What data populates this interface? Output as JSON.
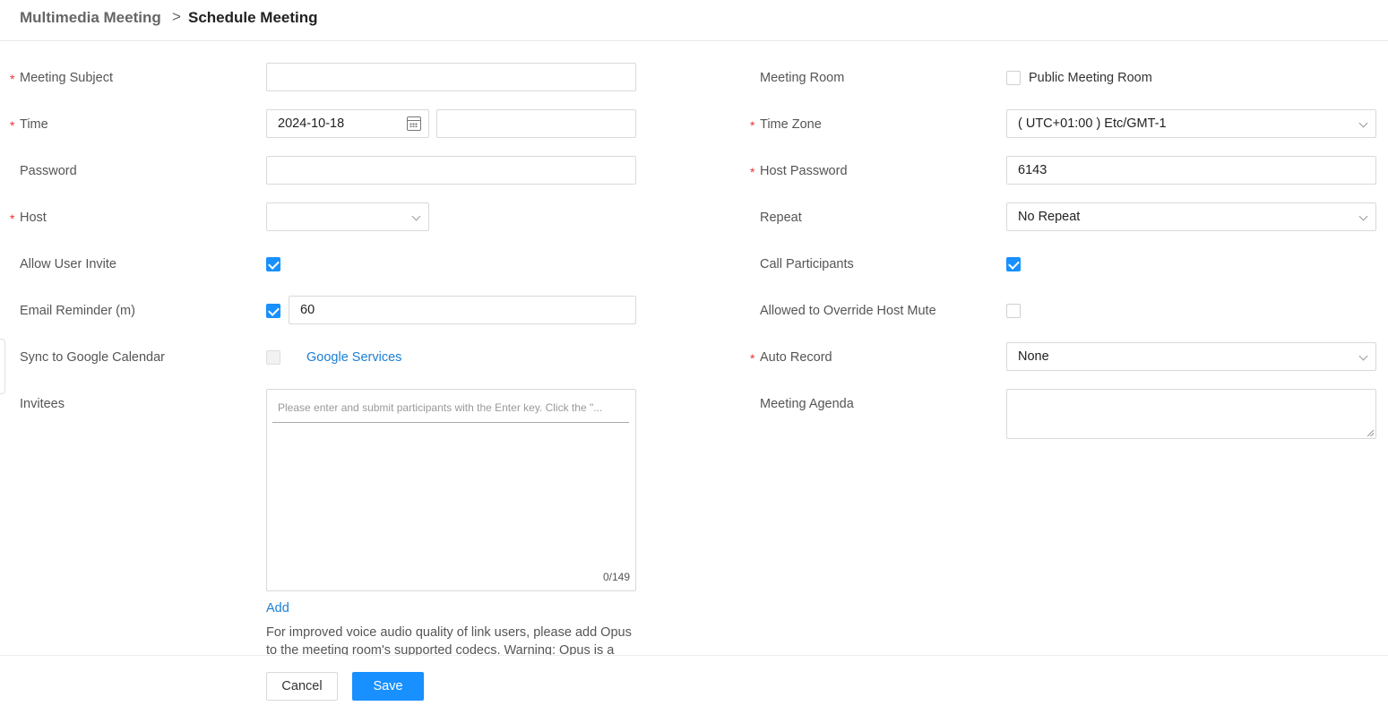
{
  "breadcrumb": {
    "parent": "Multimedia Meeting",
    "separator": ">",
    "current": "Schedule Meeting"
  },
  "left": {
    "meeting_subject": {
      "label": "Meeting Subject",
      "value": ""
    },
    "time": {
      "label": "Time",
      "date": "2024-10-18",
      "time_value": ""
    },
    "password": {
      "label": "Password",
      "value": ""
    },
    "host": {
      "label": "Host",
      "value": ""
    },
    "allow_user_invite": {
      "label": "Allow User Invite",
      "checked": true
    },
    "email_reminder": {
      "label": "Email Reminder (m)",
      "checked": true,
      "value": "60"
    },
    "sync_google": {
      "label": "Sync to Google Calendar",
      "checked": false,
      "link": "Google Services"
    },
    "invitees": {
      "label": "Invitees",
      "placeholder": "Please enter and submit participants with the Enter key. Click the \"...",
      "count": "0/149",
      "add_label": "Add",
      "note": "For improved voice audio quality of link users, please add Opus to the meeting room's supported codecs. Warning: Opus is a"
    }
  },
  "right": {
    "meeting_room": {
      "label": "Meeting Room",
      "checkbox_label": "Public Meeting Room",
      "checked": false
    },
    "time_zone": {
      "label": "Time Zone",
      "value": "( UTC+01:00 ) Etc/GMT-1"
    },
    "host_password": {
      "label": "Host Password",
      "value": "6143"
    },
    "repeat": {
      "label": "Repeat",
      "value": "No Repeat"
    },
    "call_participants": {
      "label": "Call Participants",
      "checked": true
    },
    "override_host_mute": {
      "label": "Allowed to Override Host Mute",
      "checked": false
    },
    "auto_record": {
      "label": "Auto Record",
      "value": "None"
    },
    "meeting_agenda": {
      "label": "Meeting Agenda",
      "value": ""
    }
  },
  "required_mark": "*",
  "footer": {
    "cancel_label": "Cancel",
    "save_label": "Save"
  },
  "colors": {
    "accent": "#1890ff",
    "required": "#e33333",
    "link": "#1a7fd4"
  },
  "icons": [
    "calendar-icon",
    "chevron-down-icon",
    "checkbox-checked-icon"
  ]
}
